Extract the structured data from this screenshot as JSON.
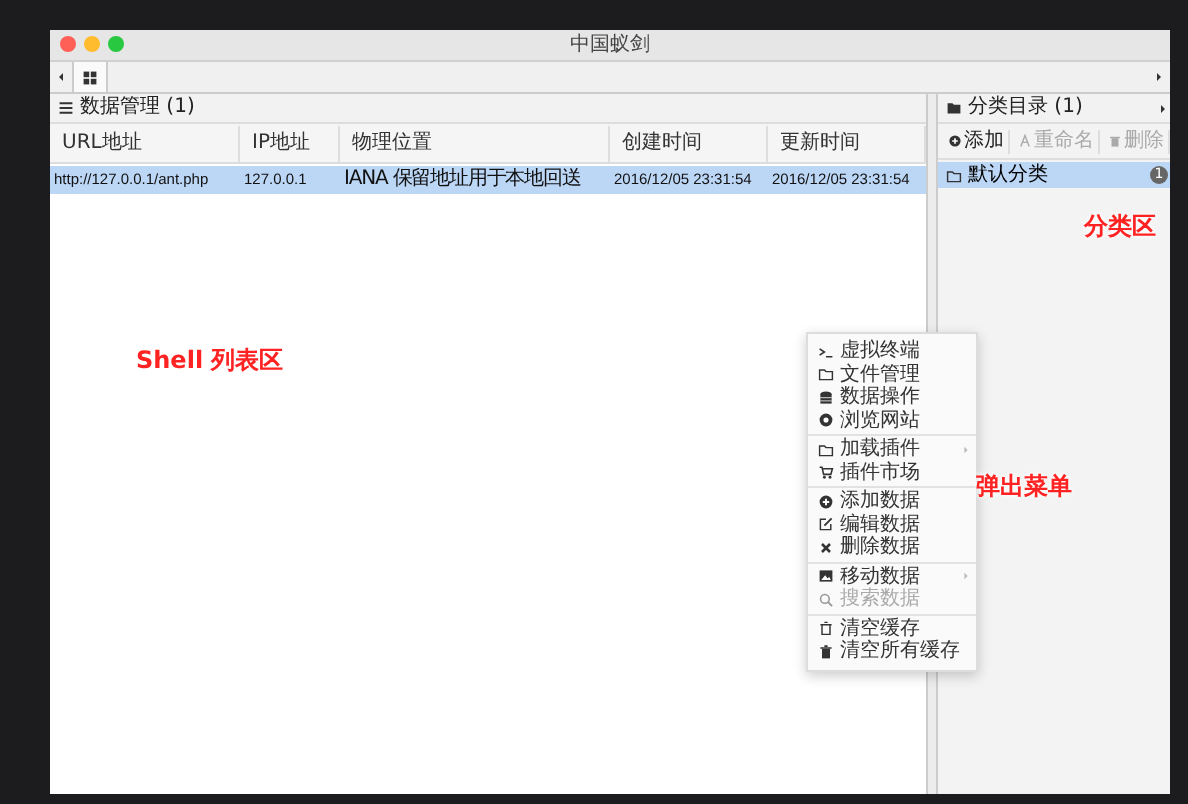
{
  "window": {
    "title": "中国蚁剑"
  },
  "shell_panel": {
    "title": "数据管理 (1)",
    "columns": [
      "URL地址",
      "IP地址",
      "物理位置",
      "创建时间",
      "更新时间"
    ],
    "rows": [
      {
        "cells": [
          "http://127.0.0.1/ant.php",
          "127.0.0.1",
          "IANA 保留地址用于本地回送",
          "2016/12/05 23:31:54",
          "2016/12/05 23:31:54"
        ],
        "selected": true
      }
    ]
  },
  "category_panel": {
    "title": "分类目录 (1)",
    "buttons": [
      {
        "label": "添加",
        "disabled": false
      },
      {
        "label": "重命名",
        "disabled": true
      },
      {
        "label": "删除",
        "disabled": true
      }
    ],
    "items": [
      {
        "label": "默认分类",
        "count": "1",
        "selected": true
      }
    ]
  },
  "context_menu": {
    "groups": [
      [
        {
          "label": "虚拟终端",
          "disabled": false,
          "submenu": false
        },
        {
          "label": "文件管理",
          "disabled": false,
          "submenu": false
        },
        {
          "label": "数据操作",
          "disabled": false,
          "submenu": false
        },
        {
          "label": "浏览网站",
          "disabled": false,
          "submenu": false
        }
      ],
      [
        {
          "label": "加载插件",
          "disabled": false,
          "submenu": true
        },
        {
          "label": "插件市场",
          "disabled": false,
          "submenu": false
        }
      ],
      [
        {
          "label": "添加数据",
          "disabled": false,
          "submenu": false
        },
        {
          "label": "编辑数据",
          "disabled": false,
          "submenu": false
        },
        {
          "label": "删除数据",
          "disabled": false,
          "submenu": false
        }
      ],
      [
        {
          "label": "移动数据",
          "disabled": false,
          "submenu": true
        },
        {
          "label": "搜索数据",
          "disabled": true,
          "submenu": false
        }
      ],
      [
        {
          "label": "清空缓存",
          "disabled": false,
          "submenu": false
        },
        {
          "label": "清空所有缓存",
          "disabled": false,
          "submenu": false
        }
      ]
    ]
  },
  "annotations": [
    {
      "text": "Shell 列表区"
    },
    {
      "text": "分类区"
    },
    {
      "text": "弹出菜单"
    }
  ]
}
